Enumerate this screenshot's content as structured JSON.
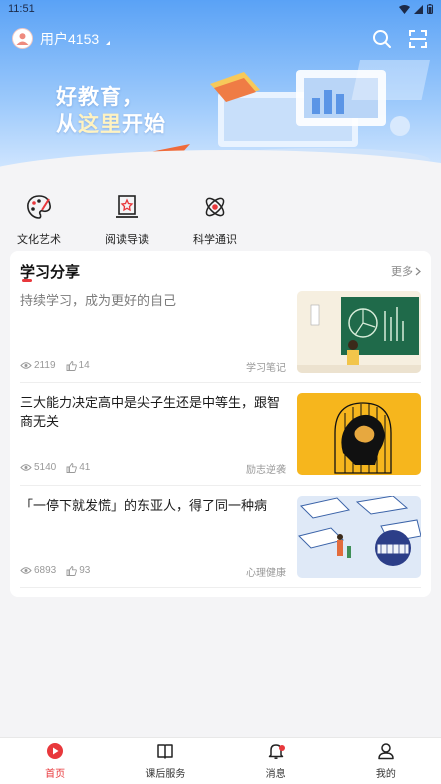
{
  "status": {
    "time": "11:51"
  },
  "user": {
    "name": "用户4153"
  },
  "banner": {
    "slogan_line1": "好教育，",
    "slogan_line2_a": "从",
    "slogan_line2_b": "这里",
    "slogan_line2_c": "开始"
  },
  "categories": [
    {
      "label": "文化艺术",
      "icon": "palette-icon"
    },
    {
      "label": "阅读导读",
      "icon": "reading-book-icon"
    },
    {
      "label": "科学通识",
      "icon": "atom-icon"
    }
  ],
  "section": {
    "title": "学习分享",
    "more": "更多"
  },
  "articles": [
    {
      "title": "持续学习，成为更好的自己",
      "views": "2119",
      "likes": "14",
      "tag": "学习笔记"
    },
    {
      "title": "三大能力决定高中是尖子生还是中等生，跟智商无关",
      "views": "5140",
      "likes": "41",
      "tag": "励志逆袭"
    },
    {
      "title": "「一停下就发慌」的东亚人，得了同一种病",
      "views": "6893",
      "likes": "93",
      "tag": "心理健康"
    }
  ],
  "tabs": [
    {
      "label": "首页",
      "icon": "home-play-icon"
    },
    {
      "label": "课后服务",
      "icon": "book-icon"
    },
    {
      "label": "消息",
      "icon": "bell-icon"
    },
    {
      "label": "我的",
      "icon": "user-icon"
    }
  ],
  "colors": {
    "accent": "#e8383c",
    "banner": "#5aa2f6"
  }
}
